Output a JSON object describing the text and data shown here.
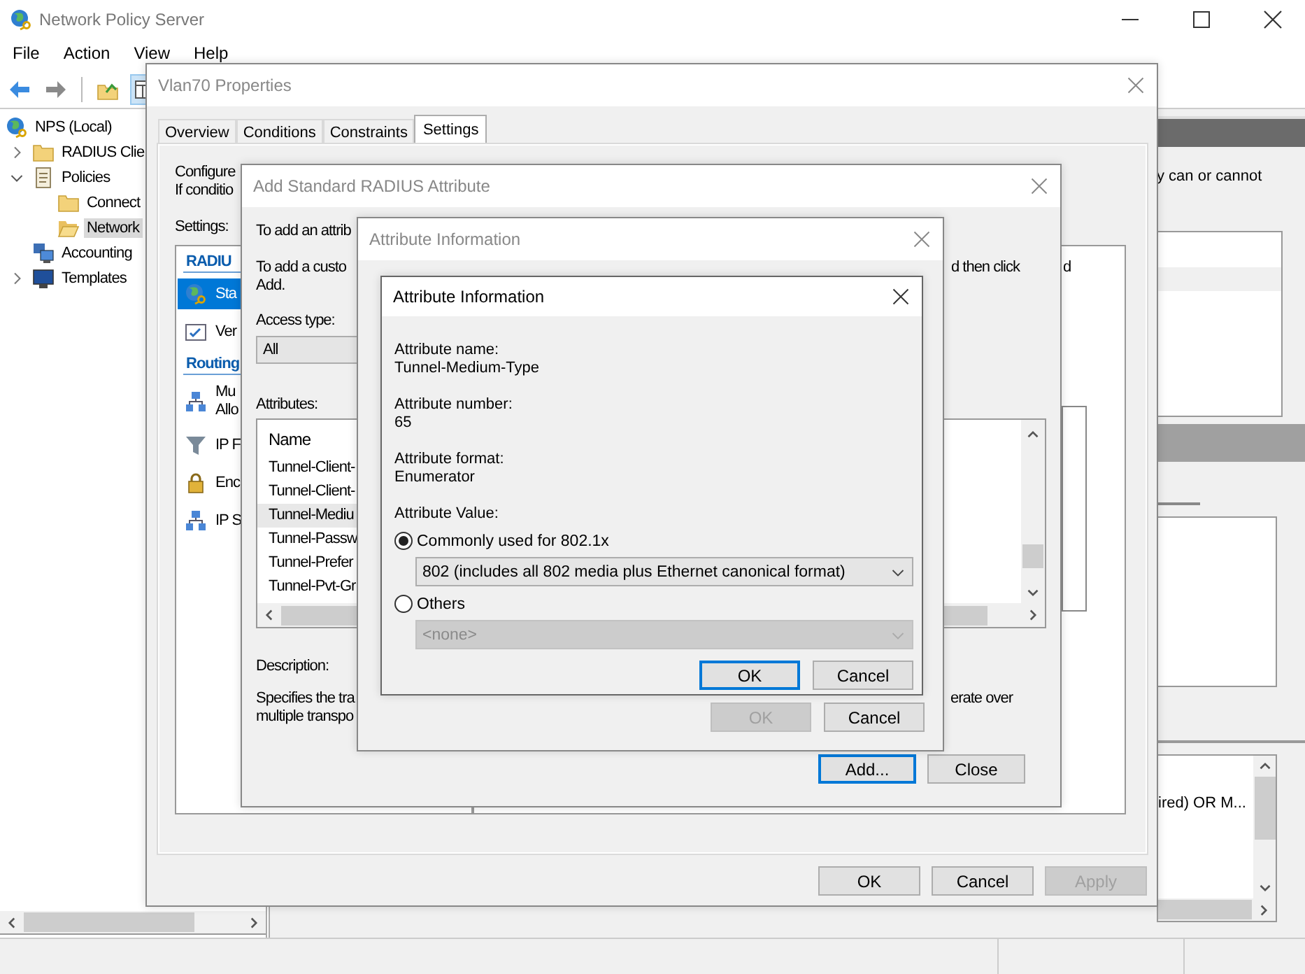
{
  "main_window": {
    "title": "Network Policy Server",
    "menu": [
      "File",
      "Action",
      "View",
      "Help"
    ],
    "tree": [
      {
        "label": "NPS (Local)",
        "kind": "globe",
        "selected": false,
        "children": [
          {
            "label": "RADIUS Clie",
            "kind": "folder",
            "expanded": false,
            "selected": false
          },
          {
            "label": "Policies",
            "kind": "scroll",
            "expanded": true,
            "selected": false,
            "children": [
              {
                "label": "Connect",
                "kind": "folder",
                "selected": false
              },
              {
                "label": "Network",
                "kind": "folder-open",
                "selected": true
              }
            ]
          },
          {
            "label": "Accounting",
            "kind": "computers",
            "selected": false
          },
          {
            "label": "Templates",
            "kind": "monitor",
            "expanded": false,
            "selected": false
          }
        ]
      }
    ],
    "right_pane": {
      "description_fragment": "y can or cannot",
      "conditions_fragment": "ired) OR M..."
    }
  },
  "properties_dialog": {
    "title": "Vlan70 Properties",
    "tabs": [
      {
        "label": "Overview",
        "selected": false
      },
      {
        "label": "Conditions",
        "selected": false
      },
      {
        "label": "Constraints",
        "selected": false
      },
      {
        "label": "Settings",
        "selected": true
      }
    ],
    "intro_lines": [
      "Configure",
      "If conditio"
    ],
    "settings_label": "Settings:",
    "settings": [
      {
        "kind": "header",
        "label": "RADIU"
      },
      {
        "kind": "globe",
        "label": "Sta",
        "selected": true
      },
      {
        "kind": "checklist",
        "label": "Ver",
        "selected": false
      },
      {
        "kind": "header",
        "label": "Routing"
      },
      {
        "kind": "network",
        "label": "Mu",
        "sublabel": "Allo",
        "selected": false
      },
      {
        "kind": "filter",
        "label": "IP F",
        "selected": false
      },
      {
        "kind": "lock",
        "label": "Enc",
        "selected": false
      },
      {
        "kind": "network",
        "label": "IP S",
        "selected": false
      }
    ],
    "detail_fragment": "d",
    "buttons": [
      {
        "label": "OK",
        "disabled": false
      },
      {
        "label": "Cancel",
        "disabled": false
      },
      {
        "label": "Apply",
        "disabled": true
      }
    ]
  },
  "add_attribute_dialog": {
    "title": "Add Standard RADIUS Attribute",
    "intro": "To add an attrib",
    "custom_intro": {
      "start": "To add a custo",
      "end": "d then click",
      "next_line": "Add."
    },
    "access_type": {
      "label": "Access type:",
      "value": "All"
    },
    "attributes": {
      "label": "Attributes:",
      "column": "Name",
      "rows": [
        {
          "label": "Tunnel-Client-",
          "selected": false
        },
        {
          "label": "Tunnel-Client-",
          "selected": false
        },
        {
          "label": "Tunnel-Mediu",
          "selected": true
        },
        {
          "label": "Tunnel-Passw",
          "selected": false
        },
        {
          "label": "Tunnel-Prefer",
          "selected": false
        },
        {
          "label": "Tunnel-Pvt-Gr",
          "selected": false
        }
      ]
    },
    "description": {
      "label": "Description:",
      "lines": [
        "Specifies the tra",
        "multiple transpo"
      ],
      "tail": "erate over"
    },
    "buttons": [
      {
        "label": "Add...",
        "default": true
      },
      {
        "label": "Close",
        "default": false
      }
    ]
  },
  "attribute_info_behind": {
    "title": "Attribute Information",
    "buttons": [
      {
        "label": "OK",
        "disabled": true
      },
      {
        "label": "Cancel",
        "disabled": false
      }
    ]
  },
  "attribute_info": {
    "title": "Attribute Information",
    "fields": [
      {
        "label": "Attribute name:",
        "value": "Tunnel-Medium-Type"
      },
      {
        "label": "Attribute number:",
        "value": "65"
      },
      {
        "label": "Attribute format:",
        "value": "Enumerator"
      }
    ],
    "value_label": "Attribute Value:",
    "options": [
      {
        "label": "Commonly used for 802.1x",
        "selected": true,
        "choice": "802 (includes all 802 media plus Ethernet canonical format)"
      },
      {
        "label": "Others",
        "selected": false,
        "choice": "<none>"
      }
    ],
    "buttons": [
      {
        "label": "OK",
        "default": true
      },
      {
        "label": "Cancel",
        "default": false
      }
    ]
  }
}
